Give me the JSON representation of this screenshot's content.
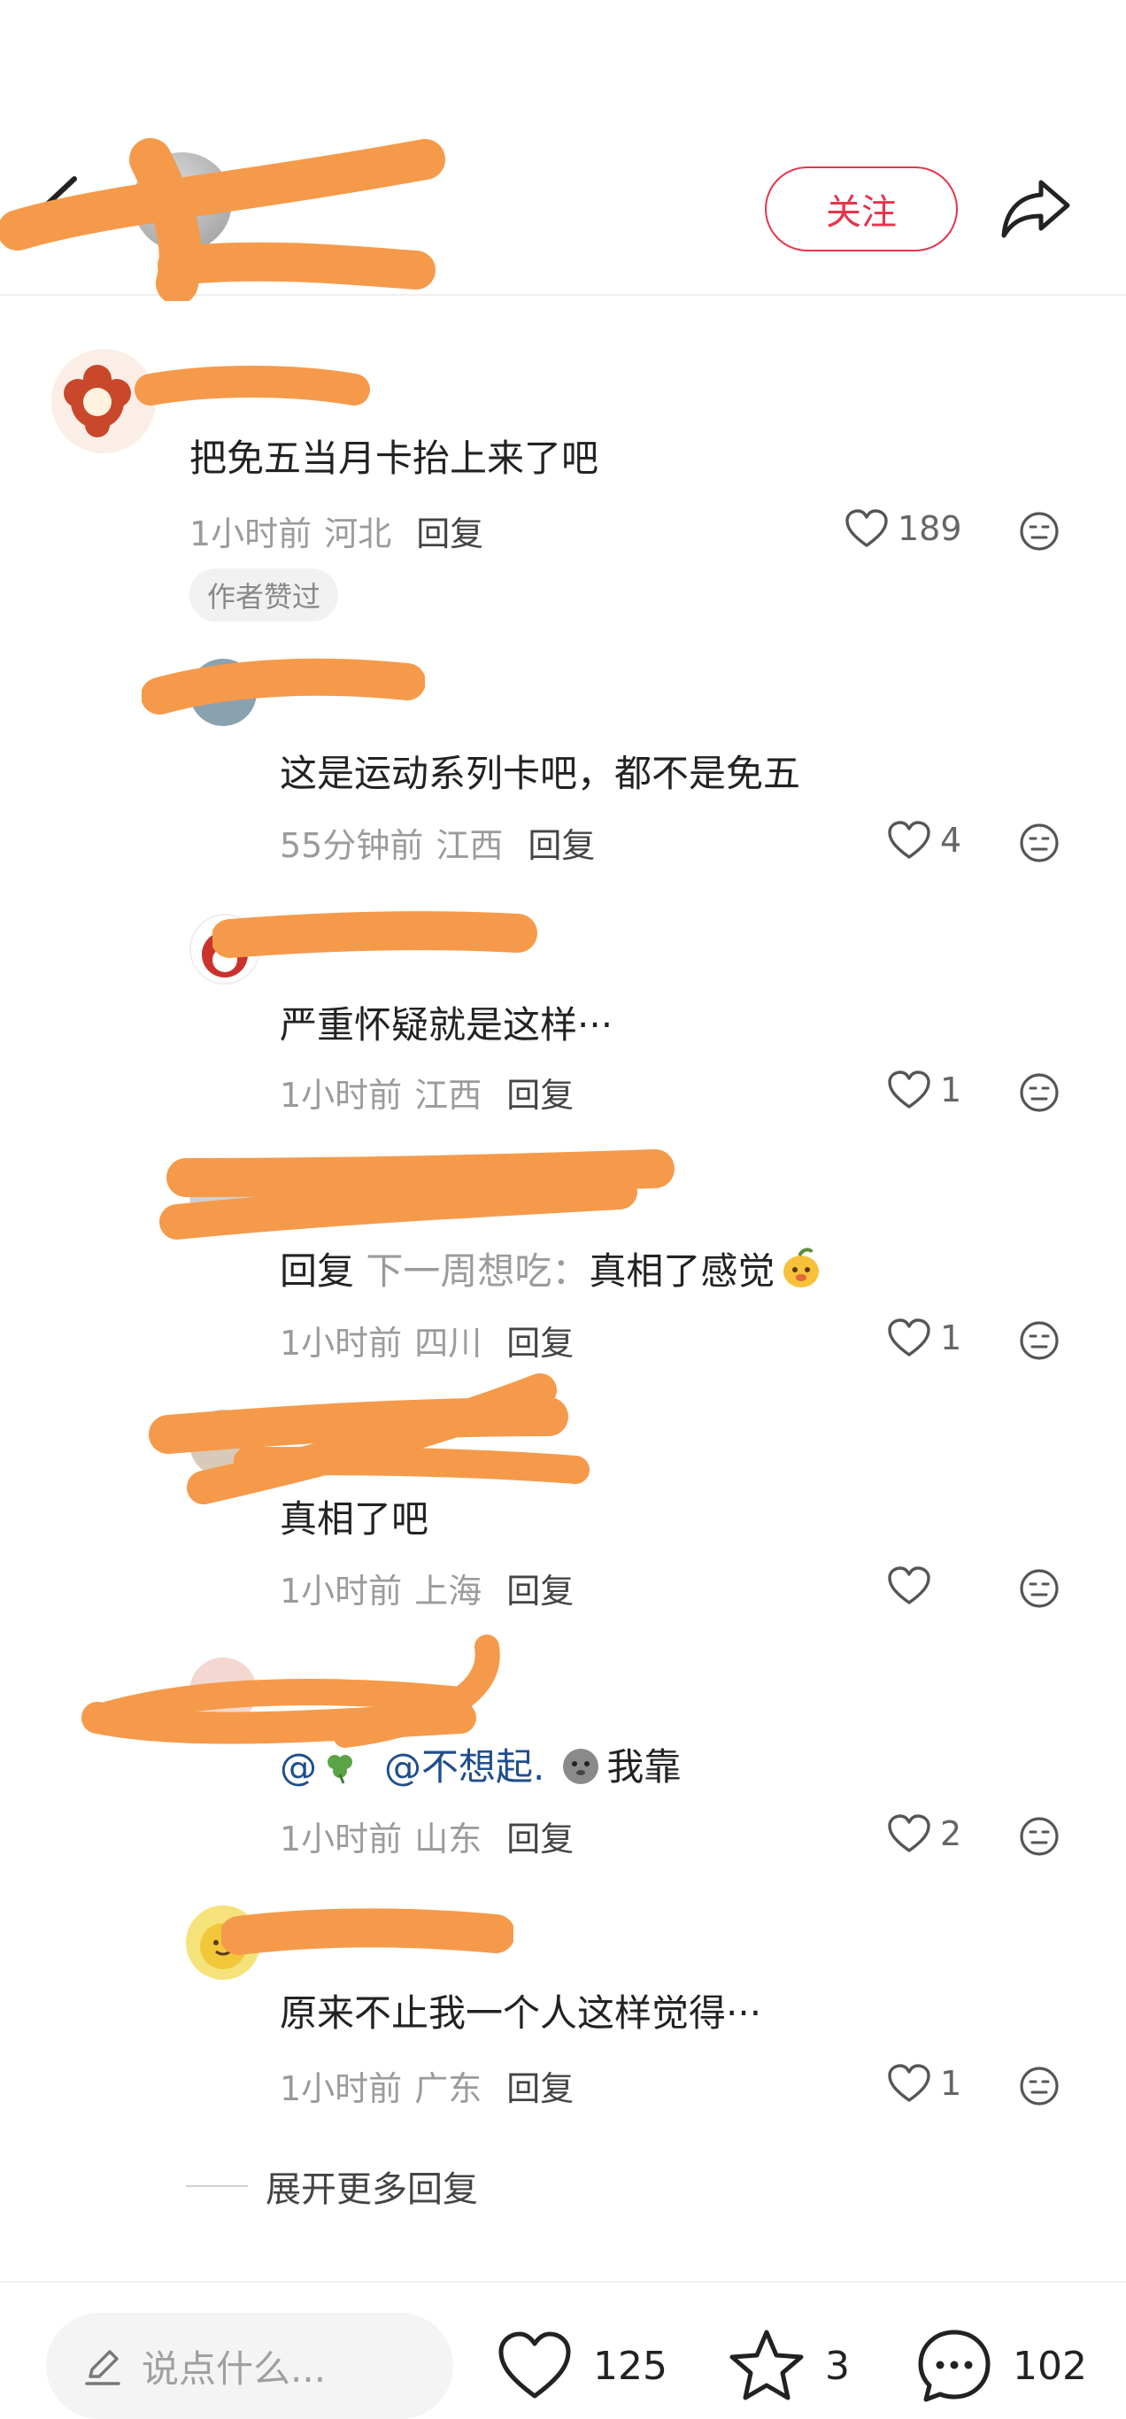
{
  "header": {
    "follow_label": "关注"
  },
  "comment": {
    "text": "把免五当月卡抬上来了吧",
    "time": "1小时前",
    "location": "河北",
    "reply_label": "回复",
    "likes": "189",
    "author_badge": "作者赞过"
  },
  "replies": [
    {
      "text": "这是运动系列卡吧，都不是免五",
      "time": "55分钟前",
      "location": "江西",
      "reply_label": "回复",
      "likes": "4"
    },
    {
      "text": "严重怀疑就是这样···",
      "time": "1小时前",
      "location": "江西",
      "reply_label": "回复",
      "likes": "1"
    },
    {
      "prefix": "回复",
      "target": "下一周想吃：",
      "text": "真相了感觉",
      "time": "1小时前",
      "location": "四川",
      "reply_label": "回复",
      "likes": "1"
    },
    {
      "text": "真相了吧",
      "time": "1小时前",
      "location": "上海",
      "reply_label": "回复",
      "likes": ""
    },
    {
      "prefix": "@",
      "target": "@不想起.",
      "text": "我靠",
      "time": "1小时前",
      "location": "山东",
      "reply_label": "回复",
      "likes": "2"
    },
    {
      "text": "原来不止我一个人这样觉得···",
      "time": "1小时前",
      "location": "广东",
      "reply_label": "回复",
      "likes": "1"
    }
  ],
  "expand_label": "展开更多回复",
  "bottom_bar": {
    "input_placeholder": "说点什么...",
    "likes": "125",
    "stars": "3",
    "comments": "102"
  },
  "colors": {
    "accent_red": "#e6344a",
    "redaction_orange": "#f59a4a",
    "meta_gray": "#9b9b9b",
    "mention_blue": "#1f4e8c"
  },
  "icons": [
    "back-arrow-icon",
    "share-icon",
    "heart-icon",
    "neutral-face-icon",
    "pencil-icon",
    "star-icon",
    "chat-bubble-icon"
  ]
}
